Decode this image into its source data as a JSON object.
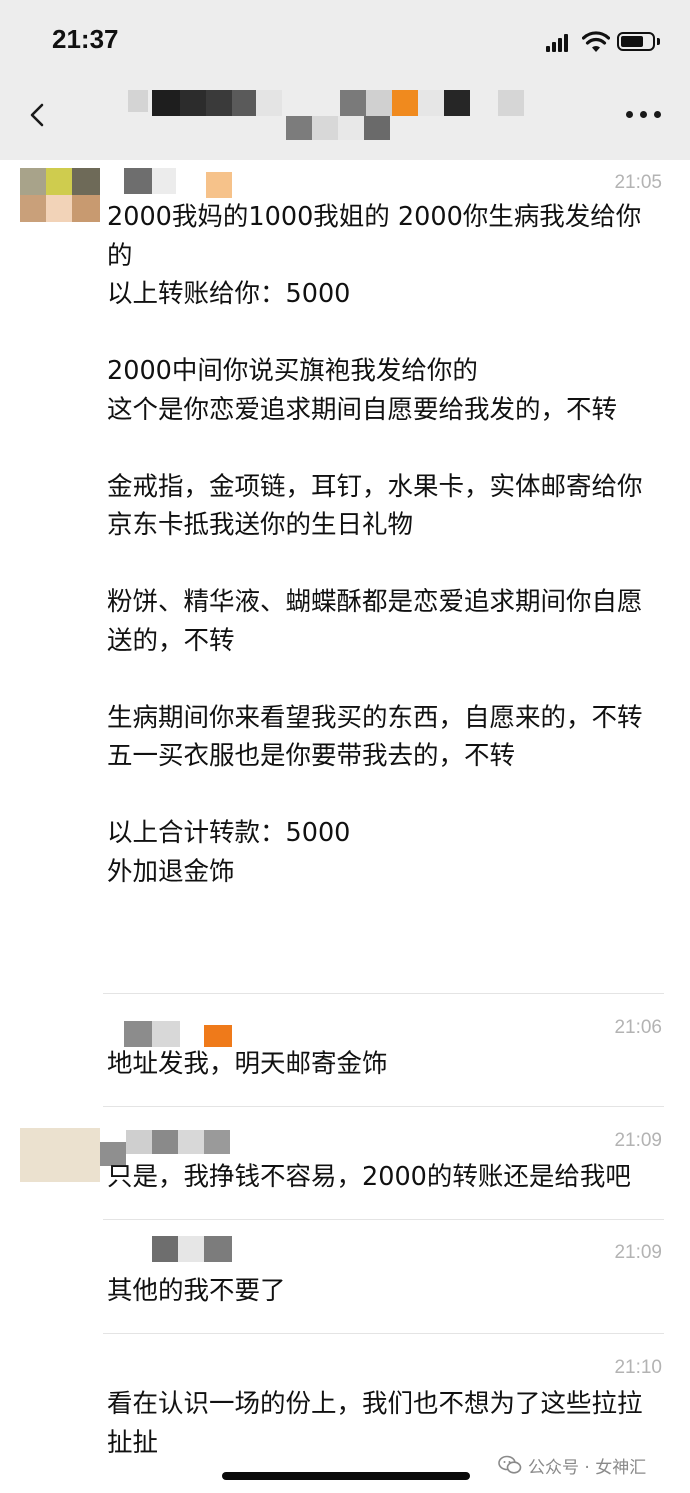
{
  "status_bar": {
    "time": "21:37"
  },
  "header": {
    "back_icon": "chevron-left-icon",
    "more_icon": "more-dots-icon"
  },
  "messages": [
    {
      "time": "21:05",
      "text": "2000我妈的1000我姐的 2000你生病我发给你的\n以上转账给你：5000\n\n2000中间你说买旗袍我发给你的\n这个是你恋爱追求期间自愿要给我发的，不转\n\n金戒指，金项链，耳钉，水果卡，实体邮寄给你\n京东卡抵我送你的生日礼物\n\n粉饼、精华液、蝴蝶酥都是恋爱追求期间你自愿送的，不转\n\n生病期间你来看望我买的东西，自愿来的，不转\n五一买衣服也是你要带我去的，不转\n\n以上合计转款：5000\n外加退金饰"
    },
    {
      "time": "21:06",
      "text": "地址发我，明天邮寄金饰"
    },
    {
      "time": "21:09",
      "text": "只是，我挣钱不容易，2000的转账还是给我吧"
    },
    {
      "time": "21:09",
      "text": "其他的我不要了"
    },
    {
      "time": "21:10",
      "text": "看在认识一场的份上，我们也不想为了这些拉拉扯扯"
    }
  ],
  "watermark": {
    "text": "公众号 · 女神汇"
  }
}
